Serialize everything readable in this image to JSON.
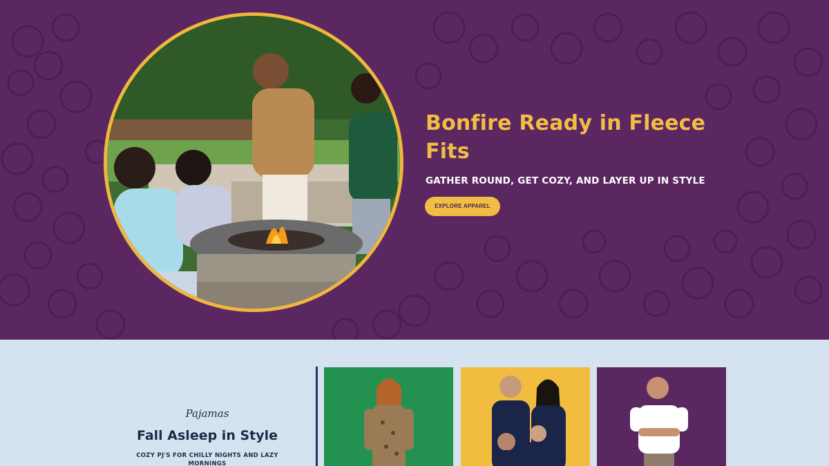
{
  "hero": {
    "title": "Bonfire Ready in Fleece Fits",
    "subtitle": "GATHER ROUND, GET COZY, AND LAYER UP IN STYLE",
    "cta_label": "EXPLORE APPAREL",
    "colors": {
      "background": "#5b2761",
      "accent": "#f2bd45"
    }
  },
  "category": {
    "eyebrow": "Pajamas",
    "title": "Fall Asleep in Style",
    "subtitle": "COZY PJ'S FOR CHILLY NIGHTS AND LAZY MORNINGS"
  },
  "cards": [
    {
      "name": "green",
      "color": "#239150"
    },
    {
      "name": "yellow",
      "color": "#f2bd3f"
    },
    {
      "name": "purple",
      "color": "#5b2761"
    }
  ]
}
